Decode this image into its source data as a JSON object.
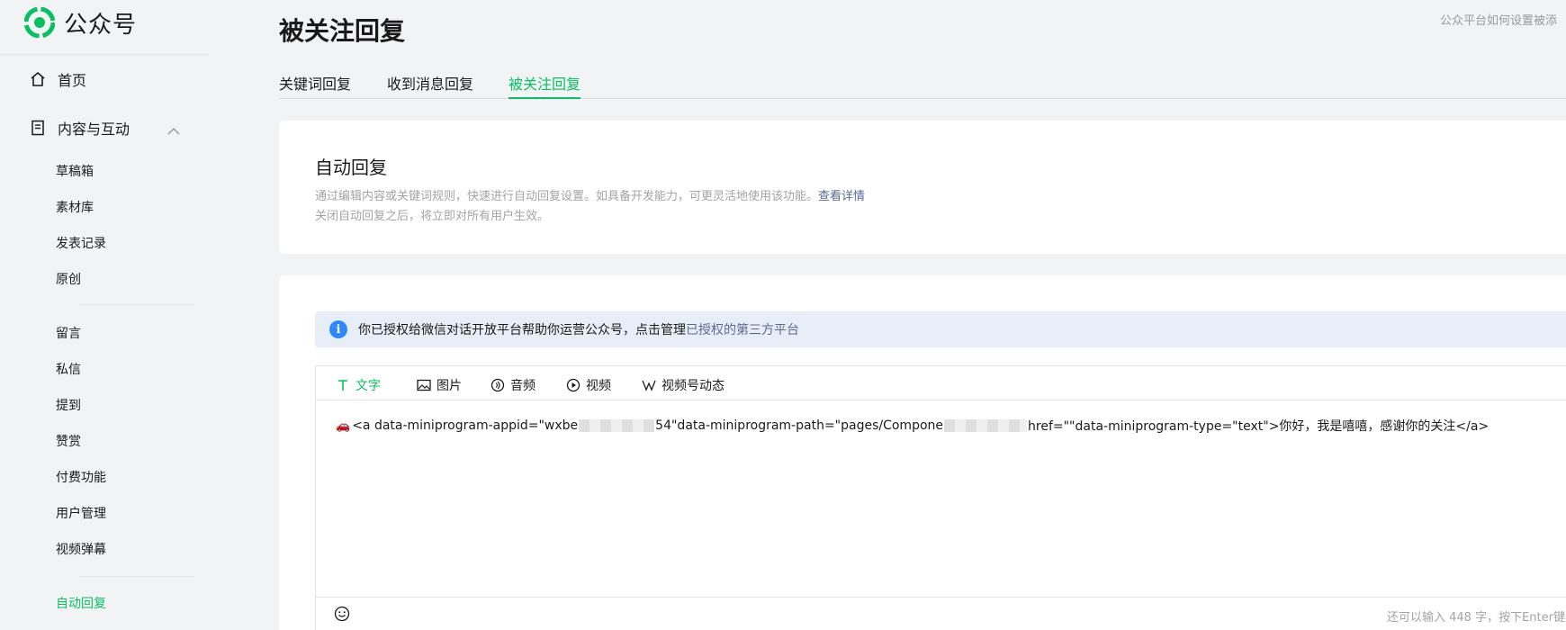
{
  "app": {
    "name": "公众号"
  },
  "colors": {
    "accent": "#07c160",
    "link": "#576b95",
    "info": "#2b88ff"
  },
  "sidebar": {
    "home": {
      "label": "首页",
      "icon": "home-icon"
    },
    "content_group": {
      "label": "内容与互动",
      "icon": "document-icon",
      "expanded": true
    },
    "items": [
      {
        "label": "草稿箱"
      },
      {
        "label": "素材库"
      },
      {
        "label": "发表记录"
      },
      {
        "label": "原创"
      },
      {
        "label": "留言"
      },
      {
        "label": "私信"
      },
      {
        "label": "提到"
      },
      {
        "label": "赞赏"
      },
      {
        "label": "付费功能"
      },
      {
        "label": "用户管理"
      },
      {
        "label": "视频弹幕"
      },
      {
        "label": "自动回复",
        "active": true
      }
    ]
  },
  "header": {
    "title": "被关注回复",
    "help_text": "公众平台如何设置被添"
  },
  "tabs": [
    {
      "label": "关键词回复"
    },
    {
      "label": "收到消息回复"
    },
    {
      "label": "被关注回复",
      "active": true
    }
  ],
  "intro": {
    "title": "自动回复",
    "desc1": "通过编辑内容或关键词规则，快速进行自动回复设置。如具备开发能力，可更灵活地使用该功能。",
    "desc_link": "查看详情",
    "desc2": "关闭自动回复之后，将立即对所有用户生效。"
  },
  "notice": {
    "text": "你已授权给微信对话开放平台帮助你运营公众号，点击管理",
    "link": "已授权的第三方平台"
  },
  "editor": {
    "tools": [
      {
        "label": "文字",
        "icon": "text-icon",
        "active": true
      },
      {
        "label": "图片",
        "icon": "image-icon"
      },
      {
        "label": "音频",
        "icon": "audio-icon"
      },
      {
        "label": "视频",
        "icon": "video-icon"
      },
      {
        "label": "视频号动态",
        "icon": "channels-icon"
      }
    ],
    "content_emoji": "🚗",
    "content_part1": "<a data-miniprogram-appid=\"wxbe",
    "content_part2": "54\"data-miniprogram-path=\"pages/Compone",
    "content_part3": "href=\"\"data-miniprogram-type=\"text\">你好，我是嘻嘻，感谢你的关注</a>",
    "counter": "还可以输入 448 字，按下Enter键"
  }
}
